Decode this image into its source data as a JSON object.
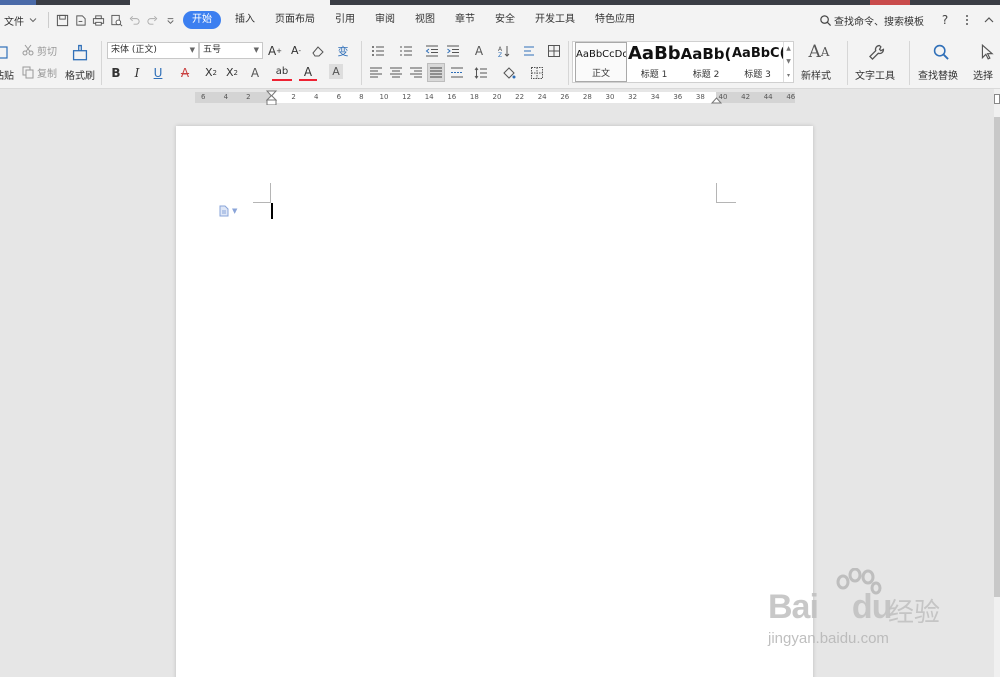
{
  "menubar": {
    "file_label": "文件",
    "tabs": [
      "开始",
      "插入",
      "页面布局",
      "引用",
      "审阅",
      "视图",
      "章节",
      "安全",
      "开发工具",
      "特色应用"
    ],
    "active_tab": "开始",
    "search_placeholder": "查找命令、搜索模板",
    "help_label": "?"
  },
  "ribbon": {
    "paste_label": "粘贴",
    "cut_label": "剪切",
    "copy_label": "复制",
    "format_painter_label": "格式刷",
    "font_name": "宋体 (正文)",
    "font_size": "五号",
    "styles": [
      {
        "sample": "AaBbCcDd",
        "name": "正文"
      },
      {
        "sample": "AaBb",
        "name": "标题 1"
      },
      {
        "sample": "AaBb(",
        "name": "标题 2"
      },
      {
        "sample": "AaBbC(",
        "name": "标题 3"
      }
    ],
    "new_style_label": "新样式",
    "text_tools_label": "文字工具",
    "find_replace_label": "查找替换",
    "select_label": "选择"
  },
  "ruler": {
    "ticks_left": [
      "6",
      "4",
      "2"
    ],
    "ticks_right": [
      "2",
      "4",
      "6",
      "8",
      "10",
      "12",
      "14",
      "16",
      "18",
      "20",
      "22",
      "24",
      "26",
      "28",
      "30",
      "32",
      "34",
      "36",
      "38",
      "40",
      "42",
      "44",
      "46"
    ]
  },
  "watermark": {
    "brand": "Bai",
    "brand2": "du",
    "cn": "经验",
    "url": "jingyan.baidu.com"
  },
  "colors": {
    "accent": "#3c7ff0",
    "toolbar_bg": "#f3f3f3",
    "workspace_bg": "#e6e6e6"
  }
}
